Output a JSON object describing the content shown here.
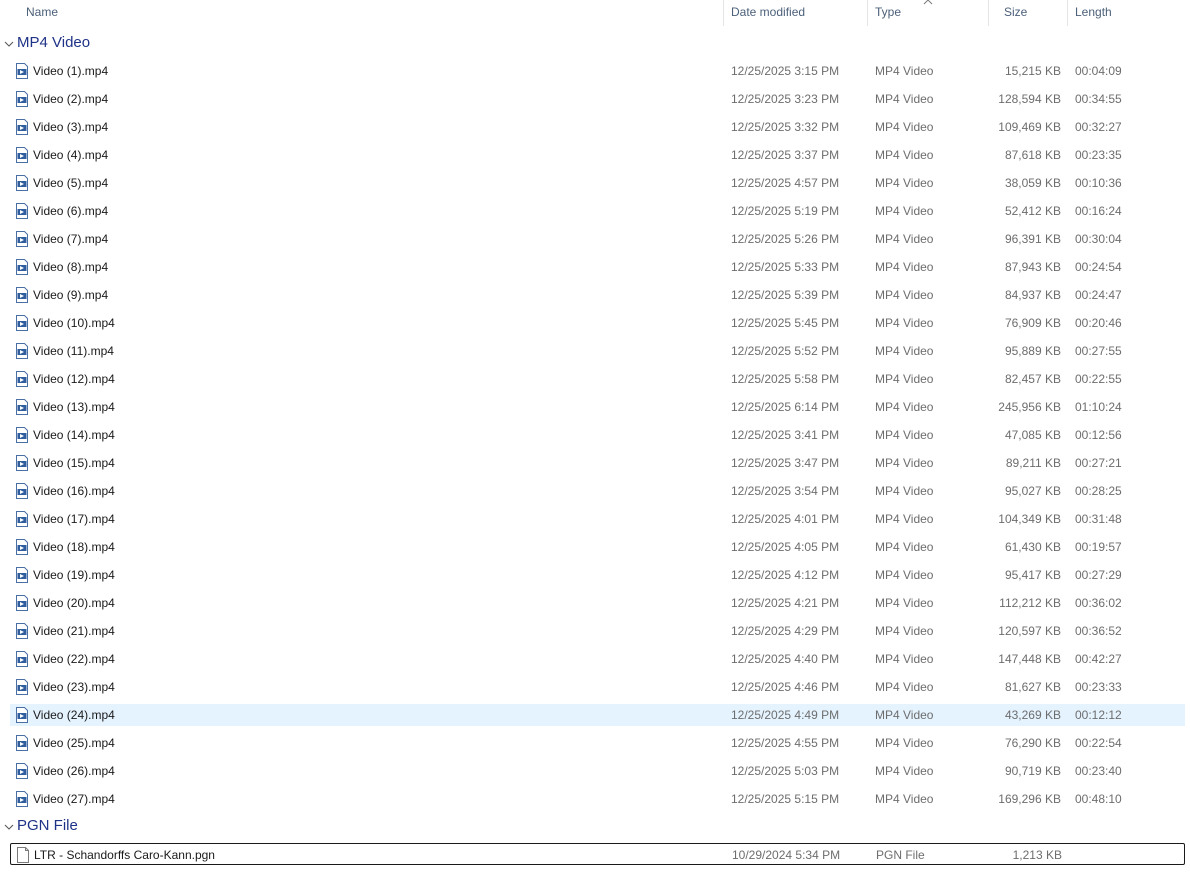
{
  "columns": {
    "name": "Name",
    "date_modified": "Date modified",
    "type": "Type",
    "size": "Size",
    "length": "Length"
  },
  "sort": {
    "column": "type",
    "direction": "ascending",
    "icon": "sort-up-arrow-icon"
  },
  "colors": {
    "group_label": "#1e3287",
    "header_text": "#4c607a",
    "selected_bg": "#e5f3ff",
    "secondary_text": "#6d6d6d"
  },
  "groups": [
    {
      "label": "MP4 Video",
      "icon": "chevron-down-icon",
      "file_icon": "video-file-icon",
      "items": [
        {
          "name": "Video (1).mp4",
          "date": "12/25/2025 3:15 PM",
          "type": "MP4 Video",
          "size": "15,215 KB",
          "length": "00:04:09"
        },
        {
          "name": "Video (2).mp4",
          "date": "12/25/2025 3:23 PM",
          "type": "MP4 Video",
          "size": "128,594 KB",
          "length": "00:34:55"
        },
        {
          "name": "Video (3).mp4",
          "date": "12/25/2025 3:32 PM",
          "type": "MP4 Video",
          "size": "109,469 KB",
          "length": "00:32:27"
        },
        {
          "name": "Video (4).mp4",
          "date": "12/25/2025 3:37 PM",
          "type": "MP4 Video",
          "size": "87,618 KB",
          "length": "00:23:35"
        },
        {
          "name": "Video (5).mp4",
          "date": "12/25/2025 4:57 PM",
          "type": "MP4 Video",
          "size": "38,059 KB",
          "length": "00:10:36"
        },
        {
          "name": "Video (6).mp4",
          "date": "12/25/2025 5:19 PM",
          "type": "MP4 Video",
          "size": "52,412 KB",
          "length": "00:16:24"
        },
        {
          "name": "Video (7).mp4",
          "date": "12/25/2025 5:26 PM",
          "type": "MP4 Video",
          "size": "96,391 KB",
          "length": "00:30:04"
        },
        {
          "name": "Video (8).mp4",
          "date": "12/25/2025 5:33 PM",
          "type": "MP4 Video",
          "size": "87,943 KB",
          "length": "00:24:54"
        },
        {
          "name": "Video (9).mp4",
          "date": "12/25/2025 5:39 PM",
          "type": "MP4 Video",
          "size": "84,937 KB",
          "length": "00:24:47"
        },
        {
          "name": "Video (10).mp4",
          "date": "12/25/2025 5:45 PM",
          "type": "MP4 Video",
          "size": "76,909 KB",
          "length": "00:20:46"
        },
        {
          "name": "Video (11).mp4",
          "date": "12/25/2025 5:52 PM",
          "type": "MP4 Video",
          "size": "95,889 KB",
          "length": "00:27:55"
        },
        {
          "name": "Video (12).mp4",
          "date": "12/25/2025 5:58 PM",
          "type": "MP4 Video",
          "size": "82,457 KB",
          "length": "00:22:55"
        },
        {
          "name": "Video (13).mp4",
          "date": "12/25/2025 6:14 PM",
          "type": "MP4 Video",
          "size": "245,956 KB",
          "length": "01:10:24"
        },
        {
          "name": "Video (14).mp4",
          "date": "12/25/2025 3:41 PM",
          "type": "MP4 Video",
          "size": "47,085 KB",
          "length": "00:12:56"
        },
        {
          "name": "Video (15).mp4",
          "date": "12/25/2025 3:47 PM",
          "type": "MP4 Video",
          "size": "89,211 KB",
          "length": "00:27:21"
        },
        {
          "name": "Video (16).mp4",
          "date": "12/25/2025 3:54 PM",
          "type": "MP4 Video",
          "size": "95,027 KB",
          "length": "00:28:25"
        },
        {
          "name": "Video (17).mp4",
          "date": "12/25/2025 4:01 PM",
          "type": "MP4 Video",
          "size": "104,349 KB",
          "length": "00:31:48"
        },
        {
          "name": "Video (18).mp4",
          "date": "12/25/2025 4:05 PM",
          "type": "MP4 Video",
          "size": "61,430 KB",
          "length": "00:19:57"
        },
        {
          "name": "Video (19).mp4",
          "date": "12/25/2025 4:12 PM",
          "type": "MP4 Video",
          "size": "95,417 KB",
          "length": "00:27:29"
        },
        {
          "name": "Video (20).mp4",
          "date": "12/25/2025 4:21 PM",
          "type": "MP4 Video",
          "size": "112,212 KB",
          "length": "00:36:02"
        },
        {
          "name": "Video (21).mp4",
          "date": "12/25/2025 4:29 PM",
          "type": "MP4 Video",
          "size": "120,597 KB",
          "length": "00:36:52"
        },
        {
          "name": "Video (22).mp4",
          "date": "12/25/2025 4:40 PM",
          "type": "MP4 Video",
          "size": "147,448 KB",
          "length": "00:42:27"
        },
        {
          "name": "Video (23).mp4",
          "date": "12/25/2025 4:46 PM",
          "type": "MP4 Video",
          "size": "81,627 KB",
          "length": "00:23:33"
        },
        {
          "name": "Video (24).mp4",
          "date": "12/25/2025 4:49 PM",
          "type": "MP4 Video",
          "size": "43,269 KB",
          "length": "00:12:12",
          "selected": true
        },
        {
          "name": "Video (25).mp4",
          "date": "12/25/2025 4:55 PM",
          "type": "MP4 Video",
          "size": "76,290 KB",
          "length": "00:22:54"
        },
        {
          "name": "Video (26).mp4",
          "date": "12/25/2025 5:03 PM",
          "type": "MP4 Video",
          "size": "90,719 KB",
          "length": "00:23:40"
        },
        {
          "name": "Video (27).mp4",
          "date": "12/25/2025 5:15 PM",
          "type": "MP4 Video",
          "size": "169,296 KB",
          "length": "00:48:10"
        }
      ]
    },
    {
      "label": "PGN File",
      "icon": "chevron-down-icon",
      "file_icon": "document-file-icon",
      "items": [
        {
          "name": "LTR - Schandorffs Caro-Kann.pgn",
          "date": "10/29/2024 5:34 PM",
          "type": "PGN File",
          "size": "1,213 KB",
          "length": "",
          "focused": true
        }
      ]
    }
  ]
}
